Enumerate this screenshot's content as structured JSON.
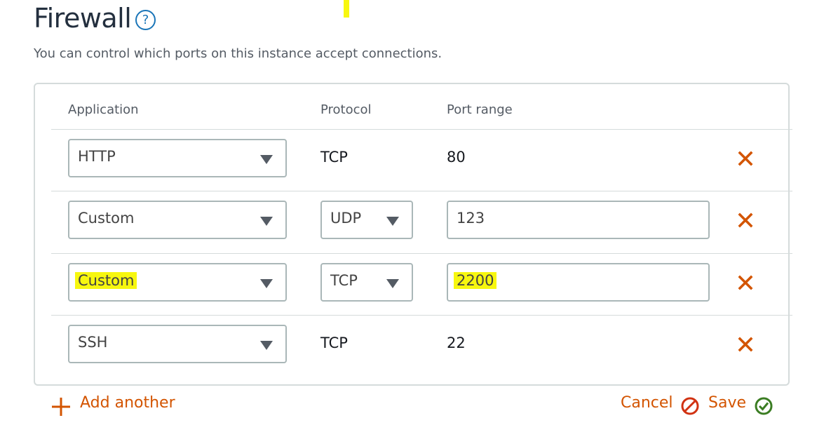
{
  "header": {
    "title": "Firewall",
    "help_glyph": "?",
    "description": "You can control which ports on this instance accept connections."
  },
  "table": {
    "columns": [
      "Application",
      "Protocol",
      "Port range"
    ],
    "rows": [
      {
        "application": "HTTP",
        "protocol": "TCP",
        "port_range": "80"
      },
      {
        "application": "Custom",
        "protocol": "UDP",
        "port_range": "123"
      },
      {
        "application": "Custom",
        "protocol": "TCP",
        "port_range": "2200"
      },
      {
        "application": "SSH",
        "protocol": "TCP",
        "port_range": "22"
      }
    ]
  },
  "footer": {
    "add_label": "Add another",
    "cancel_label": "Cancel",
    "save_label": "Save"
  },
  "colors": {
    "accent": "#d35400",
    "highlight": "#f7f70f",
    "help_blue": "#1a75b8",
    "save_green": "#3b7d23"
  },
  "icons": [
    "help-icon",
    "delete-icon",
    "plus-icon",
    "cancel-icon",
    "check-circle-icon",
    "dropdown-caret-icon"
  ]
}
